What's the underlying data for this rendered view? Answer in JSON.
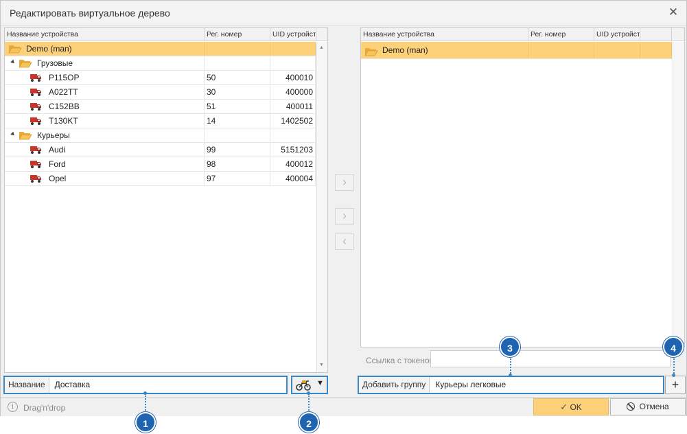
{
  "dialog": {
    "title": "Редактировать виртуальное дерево",
    "close_symbol": "✕"
  },
  "left_grid": {
    "columns": [
      "Название устройства",
      "Рег. номер",
      "UID устройства"
    ],
    "rows": [
      {
        "name": "Demo (man)",
        "reg": "",
        "uid": "",
        "icon": "folder-open-icon",
        "selected": true
      },
      {
        "name": "Грузовые",
        "reg": "",
        "uid": "",
        "icon": "folder-open-icon"
      },
      {
        "name": "P115OP",
        "reg": "50",
        "uid": "400010",
        "icon": "truck-icon"
      },
      {
        "name": "A022TT",
        "reg": "30",
        "uid": "400000",
        "icon": "truck-icon"
      },
      {
        "name": "C152BB",
        "reg": "51",
        "uid": "400011",
        "icon": "truck-icon"
      },
      {
        "name": "T130KT",
        "reg": "14",
        "uid": "1402502",
        "icon": "truck-icon"
      },
      {
        "name": "Курьеры",
        "reg": "",
        "uid": "",
        "icon": "folder-open-icon"
      },
      {
        "name": "Audi",
        "reg": "99",
        "uid": "5151203",
        "icon": "truck-icon"
      },
      {
        "name": "Ford",
        "reg": "98",
        "uid": "400012",
        "icon": "truck-icon"
      },
      {
        "name": "Opel",
        "reg": "97",
        "uid": "400004",
        "icon": "truck-icon"
      }
    ]
  },
  "right_grid": {
    "columns": [
      "Название устройства",
      "Рег. номер",
      "UID устройства",
      ""
    ],
    "rows": [
      {
        "name": "Demo (man)",
        "icon": "folder-open-icon",
        "selected": true
      }
    ]
  },
  "transfer_buttons": {
    "add": "›",
    "add2": "›",
    "remove": "‹"
  },
  "name_field": {
    "label": "Название",
    "value": "Доставка"
  },
  "icon_picker": {
    "icon": "motorcycle-icon",
    "arrow": "▼"
  },
  "token": {
    "label": "Ссылка с токеном",
    "value": ""
  },
  "add_group": {
    "label": "Добавить группу",
    "value": "Курьеры легковые",
    "button": "+"
  },
  "status": {
    "info_symbol": "i",
    "hint": "Drag'n'drop"
  },
  "footer": {
    "ok": "OK",
    "cancel": "Отмена"
  },
  "callouts": [
    "1",
    "2",
    "3",
    "4"
  ],
  "colors": {
    "accent": "#3b87c3",
    "selection": "#fdd07a",
    "callout": "#1f64b0",
    "folder": "#e9a93a"
  }
}
